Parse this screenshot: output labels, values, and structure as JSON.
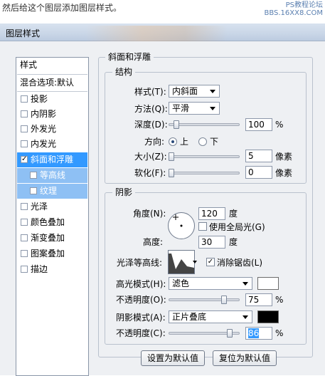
{
  "caption": "然后给这个图层添加图层样式。",
  "watermark": {
    "line1": "PS教程论坛",
    "line2": "BBS.16XX8.COM"
  },
  "dialog": {
    "title": "图层样式"
  },
  "styles_list": {
    "header": "样式",
    "blend_options": "混合选项:默认",
    "items": [
      {
        "label": "投影",
        "checked": false
      },
      {
        "label": "内阴影",
        "checked": false
      },
      {
        "label": "外发光",
        "checked": false
      },
      {
        "label": "内发光",
        "checked": false
      },
      {
        "label": "斜面和浮雕",
        "checked": true
      },
      {
        "label": "等高线",
        "checked": false
      },
      {
        "label": "纹理",
        "checked": false
      },
      {
        "label": "光泽",
        "checked": false
      },
      {
        "label": "颜色叠加",
        "checked": false
      },
      {
        "label": "渐变叠加",
        "checked": false
      },
      {
        "label": "图案叠加",
        "checked": false
      },
      {
        "label": "描边",
        "checked": false
      }
    ]
  },
  "bevel": {
    "group_title": "斜面和浮雕",
    "structure": {
      "title": "结构",
      "style_label": "样式(T):",
      "style_value": "内斜面",
      "technique_label": "方法(Q):",
      "technique_value": "平滑",
      "depth_label": "深度(D):",
      "depth_value": "100",
      "depth_unit": "%",
      "direction_label": "方向:",
      "direction_up": "上",
      "direction_down": "下",
      "size_label": "大小(Z):",
      "size_value": "5",
      "size_unit": "像素",
      "soften_label": "软化(F):",
      "soften_value": "0",
      "soften_unit": "像素"
    },
    "shading": {
      "title": "阴影",
      "angle_label": "角度(N):",
      "angle_value": "120",
      "angle_unit": "度",
      "global_light_label": "使用全局光(G)",
      "global_light_checked": false,
      "altitude_label": "高度:",
      "altitude_value": "30",
      "altitude_unit": "度",
      "gloss_contour_label": "光泽等高线:",
      "anti_alias_label": "消除锯齿(L)",
      "anti_alias_checked": true,
      "highlight_mode_label": "高光模式(H):",
      "highlight_mode_value": "滤色",
      "highlight_color": "#ffffff",
      "highlight_opacity_label": "不透明度(O):",
      "highlight_opacity_value": "75",
      "highlight_opacity_unit": "%",
      "shadow_mode_label": "阴影模式(A):",
      "shadow_mode_value": "正片叠底",
      "shadow_color": "#000000",
      "shadow_opacity_label": "不透明度(C):",
      "shadow_opacity_value": "86",
      "shadow_opacity_unit": "%"
    },
    "make_default_button": "设置为默认值",
    "reset_default_button": "复位为默认值"
  }
}
